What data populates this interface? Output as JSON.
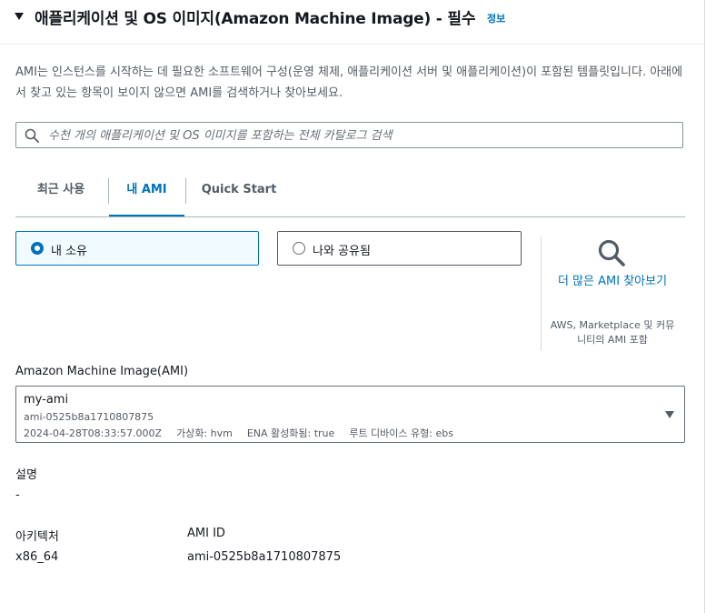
{
  "header": {
    "title": "애플리케이션 및 OS 이미지(Amazon Machine Image) - 필수",
    "info_link": "정보"
  },
  "description": "AMI는 인스턴스를 시작하는 데 필요한 소프트웨어 구성(운영 체제, 애플리케이션 서버 및 애플리케이션)이 포함된 템플릿입니다. 아래에서 찾고 있는 항목이 보이지 않으면 AMI를 검색하거나 찾아보세요.",
  "search": {
    "placeholder": "수천 개의 애플리케이션 및 OS 이미지를 포함하는 전체 카탈로그 검색",
    "value": ""
  },
  "tabs": [
    {
      "label": "최근 사용",
      "active": false
    },
    {
      "label": "내 AMI",
      "active": true
    },
    {
      "label": "Quick Start",
      "active": false
    }
  ],
  "ownership": {
    "options": [
      {
        "label": "내 소유",
        "selected": true
      },
      {
        "label": "나와 공유됨",
        "selected": false
      }
    ]
  },
  "browse": {
    "link": "더 많은 AMI 찾아보기",
    "note": "AWS, Marketplace 및 커뮤니티의 AMI 포함"
  },
  "ami_select": {
    "label": "Amazon Machine Image(AMI)",
    "name": "my-ami",
    "id": "ami-0525b8a1710807875",
    "created": "2024-04-28T08:33:57.000Z",
    "virtualization": "가상화: hvm",
    "ena": "ENA 활성화됨: true",
    "root_device": "루트 디바이스 유형: ebs"
  },
  "details": {
    "description_label": "설명",
    "description_value": "-",
    "architecture_label": "아키텍처",
    "architecture_value": "x86_64",
    "ami_id_label": "AMI ID",
    "ami_id_value": "ami-0525b8a1710807875"
  },
  "colors": {
    "link": "#0073bb",
    "selected_bg": "#f1faff",
    "text": "#16191f",
    "muted": "#545b64"
  }
}
